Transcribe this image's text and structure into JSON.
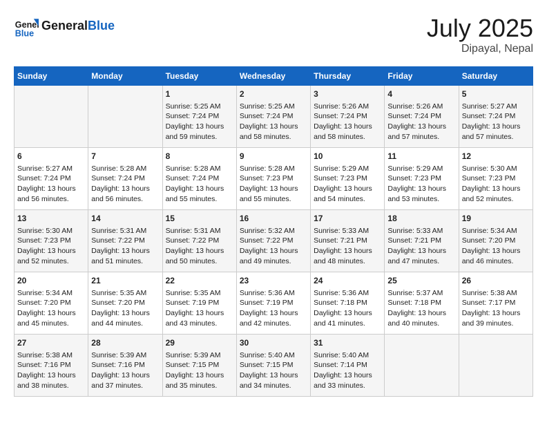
{
  "header": {
    "logo_general": "General",
    "logo_blue": "Blue",
    "month_year": "July 2025",
    "location": "Dipayal, Nepal"
  },
  "days_of_week": [
    "Sunday",
    "Monday",
    "Tuesday",
    "Wednesday",
    "Thursday",
    "Friday",
    "Saturday"
  ],
  "weeks": [
    [
      {
        "day": "",
        "info": ""
      },
      {
        "day": "",
        "info": ""
      },
      {
        "day": "1",
        "info": "Sunrise: 5:25 AM\nSunset: 7:24 PM\nDaylight: 13 hours and 59 minutes."
      },
      {
        "day": "2",
        "info": "Sunrise: 5:25 AM\nSunset: 7:24 PM\nDaylight: 13 hours and 58 minutes."
      },
      {
        "day": "3",
        "info": "Sunrise: 5:26 AM\nSunset: 7:24 PM\nDaylight: 13 hours and 58 minutes."
      },
      {
        "day": "4",
        "info": "Sunrise: 5:26 AM\nSunset: 7:24 PM\nDaylight: 13 hours and 57 minutes."
      },
      {
        "day": "5",
        "info": "Sunrise: 5:27 AM\nSunset: 7:24 PM\nDaylight: 13 hours and 57 minutes."
      }
    ],
    [
      {
        "day": "6",
        "info": "Sunrise: 5:27 AM\nSunset: 7:24 PM\nDaylight: 13 hours and 56 minutes."
      },
      {
        "day": "7",
        "info": "Sunrise: 5:28 AM\nSunset: 7:24 PM\nDaylight: 13 hours and 56 minutes."
      },
      {
        "day": "8",
        "info": "Sunrise: 5:28 AM\nSunset: 7:24 PM\nDaylight: 13 hours and 55 minutes."
      },
      {
        "day": "9",
        "info": "Sunrise: 5:28 AM\nSunset: 7:23 PM\nDaylight: 13 hours and 55 minutes."
      },
      {
        "day": "10",
        "info": "Sunrise: 5:29 AM\nSunset: 7:23 PM\nDaylight: 13 hours and 54 minutes."
      },
      {
        "day": "11",
        "info": "Sunrise: 5:29 AM\nSunset: 7:23 PM\nDaylight: 13 hours and 53 minutes."
      },
      {
        "day": "12",
        "info": "Sunrise: 5:30 AM\nSunset: 7:23 PM\nDaylight: 13 hours and 52 minutes."
      }
    ],
    [
      {
        "day": "13",
        "info": "Sunrise: 5:30 AM\nSunset: 7:23 PM\nDaylight: 13 hours and 52 minutes."
      },
      {
        "day": "14",
        "info": "Sunrise: 5:31 AM\nSunset: 7:22 PM\nDaylight: 13 hours and 51 minutes."
      },
      {
        "day": "15",
        "info": "Sunrise: 5:31 AM\nSunset: 7:22 PM\nDaylight: 13 hours and 50 minutes."
      },
      {
        "day": "16",
        "info": "Sunrise: 5:32 AM\nSunset: 7:22 PM\nDaylight: 13 hours and 49 minutes."
      },
      {
        "day": "17",
        "info": "Sunrise: 5:33 AM\nSunset: 7:21 PM\nDaylight: 13 hours and 48 minutes."
      },
      {
        "day": "18",
        "info": "Sunrise: 5:33 AM\nSunset: 7:21 PM\nDaylight: 13 hours and 47 minutes."
      },
      {
        "day": "19",
        "info": "Sunrise: 5:34 AM\nSunset: 7:20 PM\nDaylight: 13 hours and 46 minutes."
      }
    ],
    [
      {
        "day": "20",
        "info": "Sunrise: 5:34 AM\nSunset: 7:20 PM\nDaylight: 13 hours and 45 minutes."
      },
      {
        "day": "21",
        "info": "Sunrise: 5:35 AM\nSunset: 7:20 PM\nDaylight: 13 hours and 44 minutes."
      },
      {
        "day": "22",
        "info": "Sunrise: 5:35 AM\nSunset: 7:19 PM\nDaylight: 13 hours and 43 minutes."
      },
      {
        "day": "23",
        "info": "Sunrise: 5:36 AM\nSunset: 7:19 PM\nDaylight: 13 hours and 42 minutes."
      },
      {
        "day": "24",
        "info": "Sunrise: 5:36 AM\nSunset: 7:18 PM\nDaylight: 13 hours and 41 minutes."
      },
      {
        "day": "25",
        "info": "Sunrise: 5:37 AM\nSunset: 7:18 PM\nDaylight: 13 hours and 40 minutes."
      },
      {
        "day": "26",
        "info": "Sunrise: 5:38 AM\nSunset: 7:17 PM\nDaylight: 13 hours and 39 minutes."
      }
    ],
    [
      {
        "day": "27",
        "info": "Sunrise: 5:38 AM\nSunset: 7:16 PM\nDaylight: 13 hours and 38 minutes."
      },
      {
        "day": "28",
        "info": "Sunrise: 5:39 AM\nSunset: 7:16 PM\nDaylight: 13 hours and 37 minutes."
      },
      {
        "day": "29",
        "info": "Sunrise: 5:39 AM\nSunset: 7:15 PM\nDaylight: 13 hours and 35 minutes."
      },
      {
        "day": "30",
        "info": "Sunrise: 5:40 AM\nSunset: 7:15 PM\nDaylight: 13 hours and 34 minutes."
      },
      {
        "day": "31",
        "info": "Sunrise: 5:40 AM\nSunset: 7:14 PM\nDaylight: 13 hours and 33 minutes."
      },
      {
        "day": "",
        "info": ""
      },
      {
        "day": "",
        "info": ""
      }
    ]
  ]
}
